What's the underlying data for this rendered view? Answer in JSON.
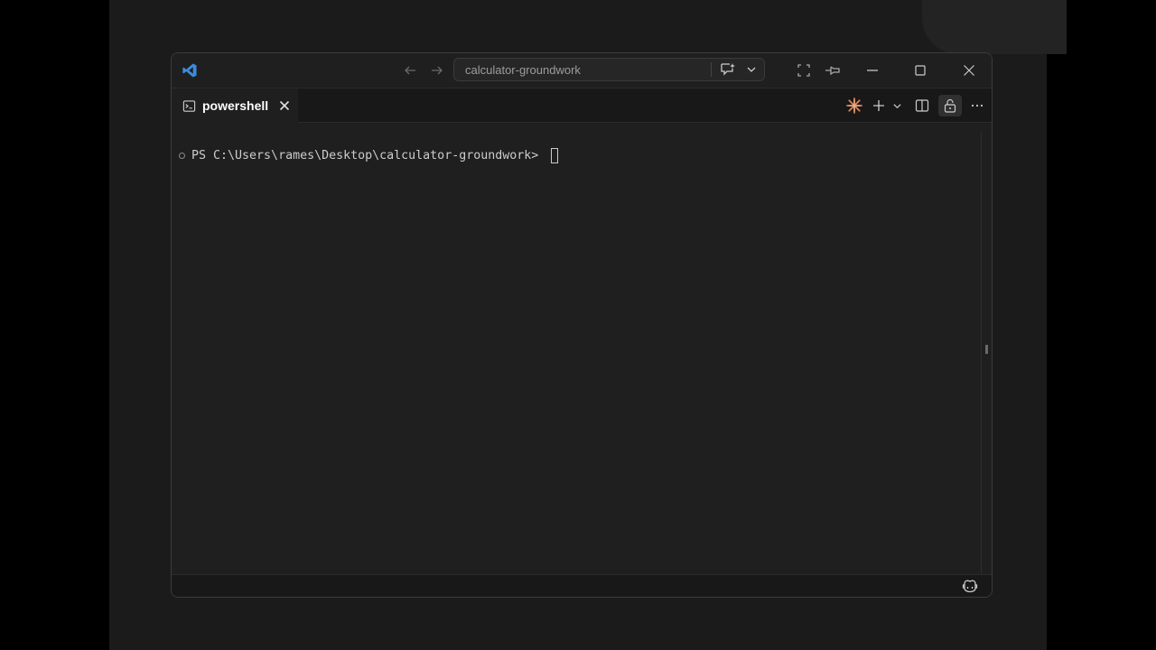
{
  "window": {
    "command_center_text": "calculator-groundwork",
    "icons": {
      "app_logo": "vscode-logo-icon",
      "back": "arrow-left-icon",
      "forward": "arrow-right-icon",
      "chat": "chat-sparkle-icon",
      "layout": "toggle-fullscreen-icon",
      "pin": "pin-icon",
      "minimize": "minimize-icon",
      "maximize": "maximize-icon",
      "close": "close-icon"
    },
    "accent_color": "#3c8bdb"
  },
  "tabs": [
    {
      "label": "powershell",
      "icon": "terminal-icon",
      "active": true
    }
  ],
  "terminal": {
    "prompt": "PS C:\\Users\\rames\\Desktop\\calculator-groundwork> "
  },
  "toolbar_icons": [
    "sparkle-icon",
    "plus-icon",
    "chevron-down-icon",
    "split-icon",
    "lock-icon",
    "more-icon"
  ],
  "status": {
    "copilot_icon": "copilot-icon"
  }
}
